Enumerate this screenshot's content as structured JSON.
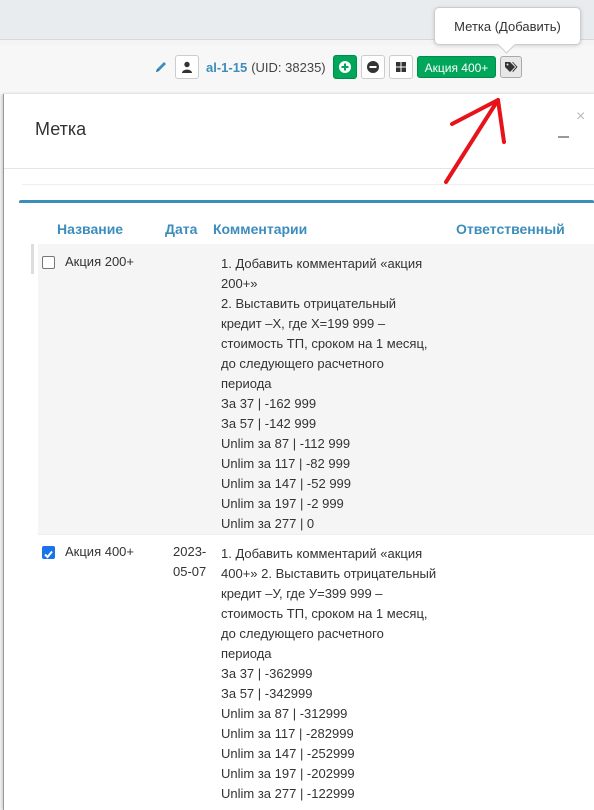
{
  "tooltip": {
    "text": "Метка (Добавить)"
  },
  "userbar": {
    "user_link": "al-1-15",
    "uid": "(UID: 38235)",
    "badge": "Акция 400+"
  },
  "modal": {
    "title": "Метка",
    "close": "×"
  },
  "table": {
    "headers": {
      "name": "Название",
      "date": "Дата",
      "comment": "Комментарии",
      "responsible": "Ответственный"
    },
    "rows": [
      {
        "checked": false,
        "name": "Акция 200+",
        "date": "",
        "comment_lines": [
          "1. Добавить комментарий «акция",
          "200+»",
          "2. Выставить отрицательный",
          "кредит –Х, где Х=199 999 –",
          "стоимость ТП, сроком на 1 месяц,",
          "до следующего расчетного",
          "периода",
          "За 37 | -162 999",
          "За 57 | -142 999",
          "Unlim за 87 | -112 999",
          "Unlim за 117 | -82 999",
          "Unlim за 147 | -52 999",
          "Unlim за 197 | -2 999",
          "Unlim за 277 | 0"
        ]
      },
      {
        "checked": true,
        "name": "Акция 400+",
        "date_line1": "2023-",
        "date_line2": "05-07",
        "comment_lines": [
          "1. Добавить комментарий «акция",
          "400+» 2. Выставить отрицательный",
          "кредит –У, где У=399 999 –",
          "стоимость ТП, сроком на 1 месяц,",
          "до следующего расчетного",
          "периода",
          "За 37 | -362999",
          "За 57 | -342999",
          "Unlim за 87 | -312999",
          "Unlim за 117 | -282999",
          "Unlim за 147 | -252999",
          "Unlim за 197 | -202999",
          "Unlim за 277 | -122999"
        ]
      }
    ]
  },
  "colors": {
    "accent": "#3c8dbc",
    "green": "#00a65a",
    "arrow": "#e8121b"
  },
  "icons": [
    "pencil-icon",
    "user-icon",
    "plus-circle-icon",
    "minus-circle-icon",
    "grid-icon",
    "tags-icon",
    "close-icon"
  ]
}
